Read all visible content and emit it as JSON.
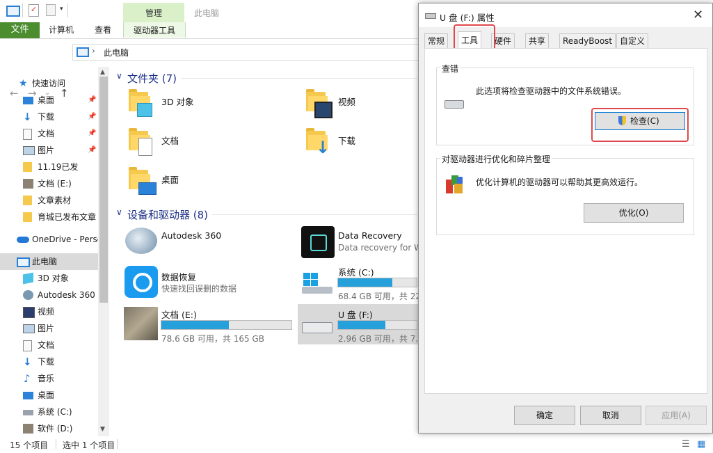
{
  "ribbon": {
    "context_label": "管理",
    "context_tab": "驱动器工具",
    "title": "此电脑",
    "tabs": [
      "文件",
      "计算机",
      "查看"
    ]
  },
  "address": {
    "location": "此电脑",
    "separator": "›"
  },
  "sidebar": {
    "quick_access": "快速访问",
    "items": [
      {
        "label": "桌面",
        "pinned": true
      },
      {
        "label": "下载",
        "pinned": true
      },
      {
        "label": "文档",
        "pinned": true
      },
      {
        "label": "图片",
        "pinned": true
      },
      {
        "label": "11.19已发",
        "pinned": false
      },
      {
        "label": "文档 (E:)",
        "pinned": false
      },
      {
        "label": "文章素材",
        "pinned": false
      },
      {
        "label": "育城已发布文章",
        "pinned": false
      },
      {
        "label": "OneDrive - Perso",
        "pinned": false
      },
      {
        "label": "此电脑",
        "pinned": false
      },
      {
        "label": "3D 对象",
        "pinned": false
      },
      {
        "label": "Autodesk 360",
        "pinned": false
      },
      {
        "label": "视频",
        "pinned": false
      },
      {
        "label": "图片",
        "pinned": false
      },
      {
        "label": "文档",
        "pinned": false
      },
      {
        "label": "下载",
        "pinned": false
      },
      {
        "label": "音乐",
        "pinned": false
      },
      {
        "label": "桌面",
        "pinned": false
      },
      {
        "label": "系统 (C:)",
        "pinned": false
      },
      {
        "label": "软件 (D:)",
        "pinned": false
      }
    ]
  },
  "content": {
    "folders_header": "文件夹 (7)",
    "folders": [
      "3D 对象",
      "视频",
      "文档",
      "下载",
      "桌面"
    ],
    "devices_header": "设备和驱动器 (8)",
    "devices": [
      {
        "name": "Autodesk 360",
        "sub": ""
      },
      {
        "name": "Data Recovery",
        "sub": "Data recovery for W"
      },
      {
        "name": "数据恢复",
        "sub": "快速找回误删的数据"
      },
      {
        "name": "系统 (C:)",
        "sub": "68.4 GB 可用，共 22",
        "usage": 0.69
      },
      {
        "name": "文档 (E:)",
        "sub": "78.6 GB 可用，共 165 GB",
        "usage": 0.52
      },
      {
        "name": "U 盘 (F:)",
        "sub": "2.96 GB 可用，共 7.4",
        "usage": 0.6
      }
    ]
  },
  "status": {
    "count": "15 个项目",
    "selected": "选中 1 个项目"
  },
  "dialog": {
    "title": "U 盘 (F:) 属性",
    "tabs": [
      "常规",
      "工具",
      "硬件",
      "共享",
      "ReadyBoost",
      "自定义"
    ],
    "check_group": "查错",
    "check_desc": "此选项将检查驱动器中的文件系统错误。",
    "check_button": "检查(C)",
    "opt_group": "对驱动器进行优化和碎片整理",
    "opt_desc": "优化计算机的驱动器可以帮助其更高效运行。",
    "opt_button": "优化(O)",
    "ok": "确定",
    "cancel": "取消",
    "apply": "应用(A)"
  },
  "colors": {
    "file_tab": "#4b8d2f",
    "context_tab": "#d9f0c9",
    "bar_fill": "#26a0da",
    "highlight": "#e0474c",
    "group_header": "#1e3287"
  }
}
